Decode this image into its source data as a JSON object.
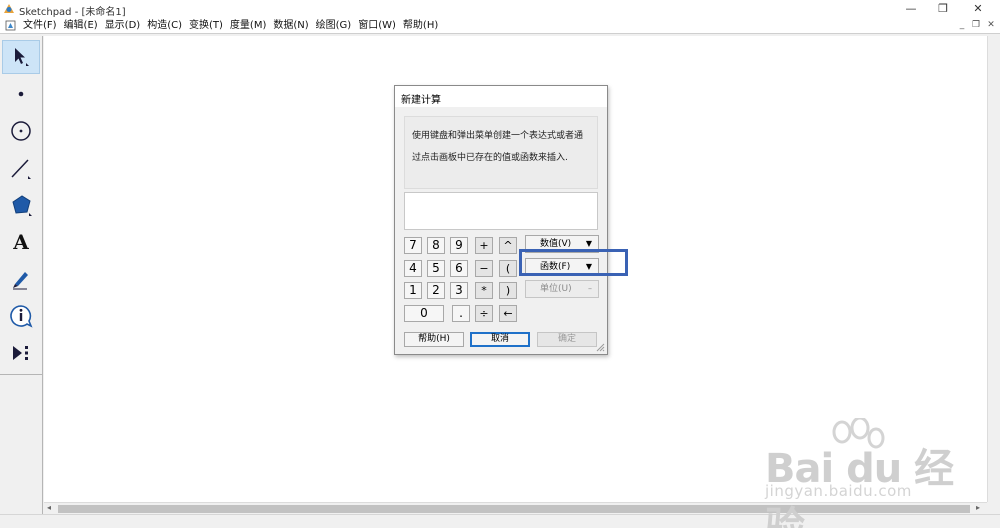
{
  "window": {
    "title": "Sketchpad - [未命名1]",
    "controls": {
      "minimize": "—",
      "restore": "❐",
      "close": "✕"
    }
  },
  "menubar": {
    "items": [
      "文件(F)",
      "编辑(E)",
      "显示(D)",
      "构造(C)",
      "变换(T)",
      "度量(M)",
      "数据(N)",
      "绘图(G)",
      "窗口(W)",
      "帮助(H)"
    ],
    "mdi_controls": {
      "minimize": "_",
      "restore": "❐",
      "close": "✕"
    }
  },
  "toolbox": {
    "tools": [
      "arrow-select-tool",
      "point-tool",
      "compass-tool",
      "straightedge-tool",
      "polygon-tool",
      "text-tool",
      "marker-tool",
      "information-tool",
      "custom-tool"
    ],
    "text_tool_glyph": "A",
    "active_tool": "arrow-select-tool"
  },
  "dialog": {
    "title": "新建计算",
    "description": "使用键盘和弹出菜单创建一个表达式或者通过点击画板中已存在的值或函数来插入.",
    "keypad": {
      "row1": [
        "7",
        "8",
        "9",
        "+",
        "^"
      ],
      "row2": [
        "4",
        "5",
        "6",
        "−",
        "("
      ],
      "row3": [
        "1",
        "2",
        "3",
        "*",
        ")"
      ],
      "row4": [
        "0",
        ".",
        "÷",
        "←"
      ]
    },
    "popups": {
      "values": "数值(V)",
      "functions": "函数(F)",
      "units": "单位(U)"
    },
    "buttons": {
      "help": "帮助(H)",
      "cancel": "取消",
      "ok": "确定"
    }
  },
  "watermark": {
    "logo": "Bai du 经验",
    "url": "jingyan.baidu.com"
  },
  "colors": {
    "highlight_frame": "#3a62b4",
    "default_button_border": "#1f71c9",
    "active_tool_bg": "#cde4f7"
  }
}
